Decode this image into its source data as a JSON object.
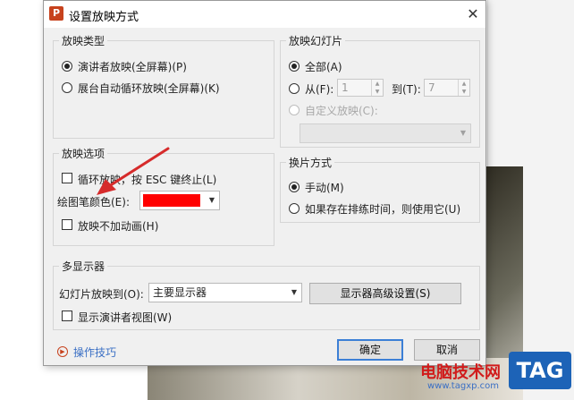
{
  "window": {
    "title": "设置放映方式",
    "app_icon_letter": "P",
    "close_symbol": "✕"
  },
  "show_type": {
    "label": "放映类型",
    "options": [
      {
        "label": "演讲者放映(全屏幕)(P)",
        "selected": true
      },
      {
        "label": "展台自动循环放映(全屏幕)(K)",
        "selected": false
      }
    ]
  },
  "slides": {
    "label": "放映幻灯片",
    "all_label": "全部(A)",
    "from_label": "从(F):",
    "from_value": "1",
    "to_label": "到(T):",
    "to_value": "7",
    "custom_label": "自定义放映(C):"
  },
  "show_options": {
    "label": "放映选项",
    "loop_label": "循环放映，按 ESC 键终止(L)",
    "pen_color_label": "绘图笔颜色(E):",
    "pen_color": "#ff0000",
    "no_animation_label": "放映不加动画(H)"
  },
  "advance": {
    "label": "换片方式",
    "manual_label": "手动(M)",
    "timing_label": "如果存在排练时间，则使用它(U)"
  },
  "multi_monitor": {
    "label": "多显示器",
    "show_on_label": "幻灯片放映到(O):",
    "show_on_value": "主要显示器",
    "advanced_button": "显示器高级设置(S)",
    "presenter_view_label": "显示演讲者视图(W)"
  },
  "footer": {
    "tips_label": "操作技巧",
    "ok": "确定",
    "cancel": "取消"
  },
  "watermark": {
    "site_name": "电脑技术网",
    "url": "www.tagxp.com",
    "logo": "TAG"
  },
  "colors": {
    "accent": "#3c7fd6",
    "annotation_arrow": "#d62b2b",
    "app_icon": "#c7421d"
  }
}
